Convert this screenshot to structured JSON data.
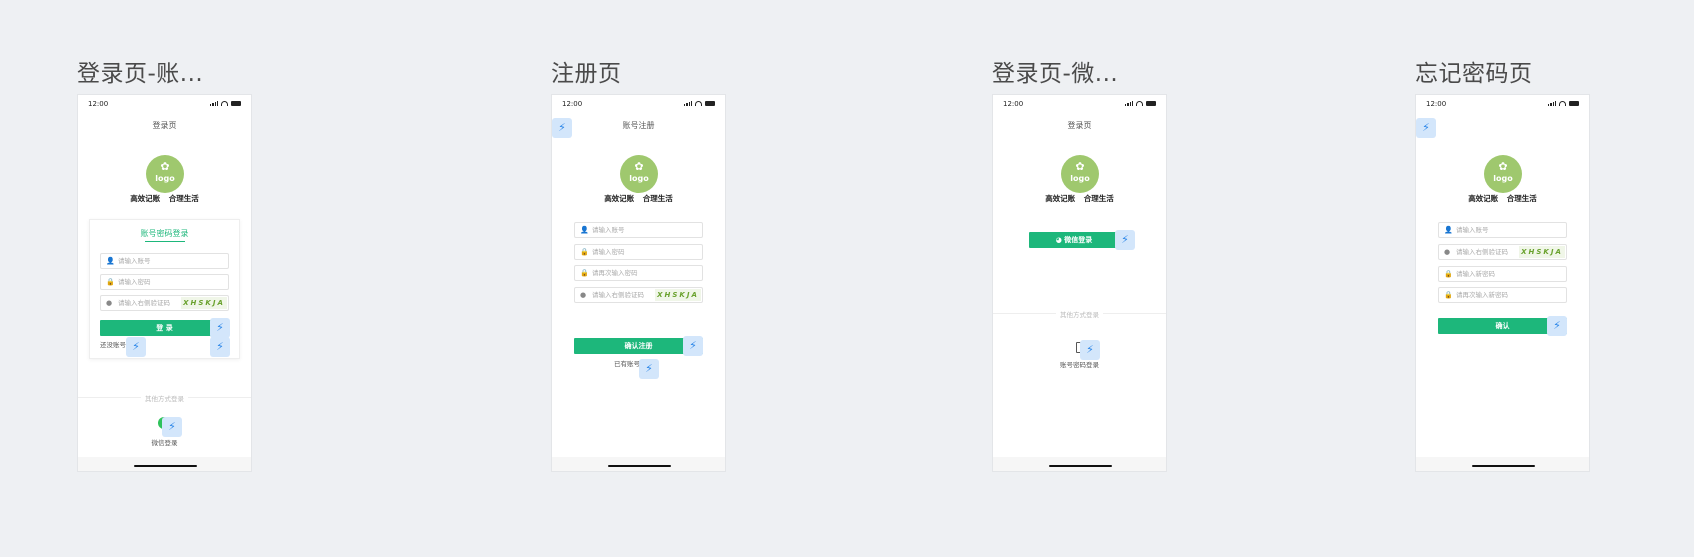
{
  "boards": [
    {
      "title": "登录页-账..."
    },
    {
      "title": "注册页"
    },
    {
      "title": "登录页-微..."
    },
    {
      "title": "忘记密码页"
    }
  ],
  "status_time": "12:00",
  "logo_text": "logo",
  "slogan": "高效记账 合理生活",
  "login_account": {
    "nav_title": "登录页",
    "tab_label": "账号密码登录",
    "account_placeholder": "请输入账号",
    "password_placeholder": "请输入密码",
    "captcha_placeholder": "请输入右侧验证码",
    "captcha_code": "XHSKJA",
    "login_button": "登 录",
    "register_link": "还没账号?",
    "other_login": "其他方式登录",
    "wechat_login": "微信登录"
  },
  "register": {
    "nav_title": "账号注册",
    "account_placeholder": "请输入账号",
    "password_placeholder": "请输入密码",
    "confirm_placeholder": "请再次输入密码",
    "captcha_placeholder": "请输入右侧验证码",
    "captcha_code": "XHSKJA",
    "submit_button": "确认注册",
    "login_link": "已有账号?"
  },
  "login_wechat": {
    "nav_title": "登录页",
    "wechat_button": "微信登录",
    "other_login": "其他方式登录",
    "account_login": "账号密码登录"
  },
  "forgot": {
    "account_placeholder": "请输入账号",
    "captcha_placeholder": "请输入右侧验证码",
    "captcha_code": "XHSKJA",
    "new_password_placeholder": "请输入新密码",
    "confirm_placeholder": "请再次输入新密码",
    "confirm_button": "确认"
  },
  "colors": {
    "primary": "#1db77b",
    "logo": "#9fc86e",
    "bolt": "#2b86e8",
    "background": "#eef0f3"
  }
}
